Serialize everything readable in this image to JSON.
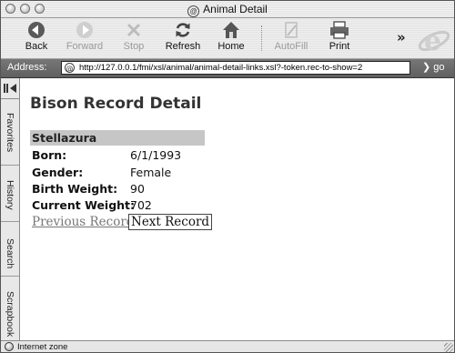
{
  "window": {
    "title": "Animal Detail"
  },
  "toolbar": {
    "back": "Back",
    "forward": "Forward",
    "stop": "Stop",
    "refresh": "Refresh",
    "home": "Home",
    "autofill": "AutoFill",
    "print": "Print",
    "more": "»"
  },
  "address": {
    "label": "Address:",
    "url": "http://127.0.0.1/fmi/xsl/animal/animal-detail-links.xsl?-token.rec-to-show=2",
    "go": "go"
  },
  "sidebar": {
    "tabs": [
      "Favorites",
      "History",
      "Search",
      "Scrapbook"
    ]
  },
  "page": {
    "title": "Bison Record Detail",
    "record_name": "Stellazura",
    "fields": [
      {
        "label": "Born:",
        "value": "6/1/1993"
      },
      {
        "label": "Gender:",
        "value": "Female"
      },
      {
        "label": "Birth Weight:",
        "value": "90"
      },
      {
        "label": "Current Weight:",
        "value": "702"
      }
    ],
    "prev_link": "Previous Record",
    "next_link": "Next Record"
  },
  "status": {
    "text": "Internet zone"
  },
  "icons": {
    "back": "back-arrow-icon",
    "forward": "forward-arrow-icon",
    "stop": "stop-x-icon",
    "refresh": "refresh-icon",
    "home": "home-icon",
    "autofill": "autofill-icon",
    "print": "printer-icon",
    "browser": "ie-logo-icon"
  }
}
